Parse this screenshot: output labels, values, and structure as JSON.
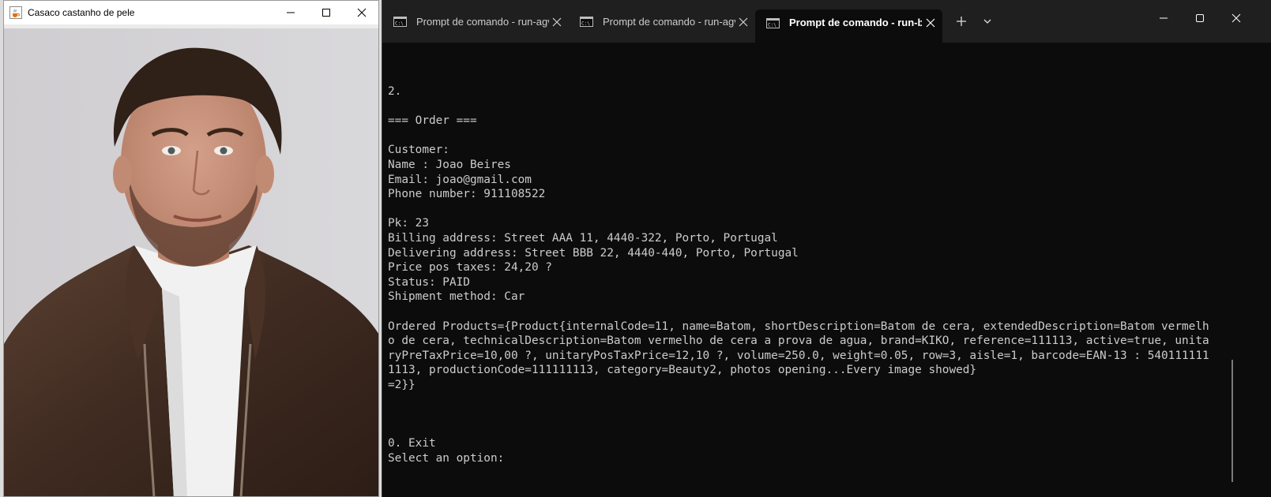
{
  "image_window": {
    "title": "Casaco castanho de pele",
    "icon": "java-coffee-cup-icon"
  },
  "terminal": {
    "tabs": [
      {
        "label": "Prompt de comando - run-agv",
        "active": false
      },
      {
        "label": "Prompt de comando - run-agv",
        "active": false
      },
      {
        "label": "Prompt de comando - run-ba",
        "active": true
      }
    ],
    "lines": [
      "2.",
      "",
      "=== Order ===",
      "",
      "Customer:",
      "Name : Joao Beires",
      "Email: joao@gmail.com",
      "Phone number: 911108522",
      "",
      "Pk: 23",
      "Billing address: Street AAA 11, 4440-322, Porto, Portugal",
      "Delivering address: Street BBB 22, 4440-440, Porto, Portugal",
      "Price pos taxes: 24,20 ?",
      "Status: PAID",
      "Shipment method: Car",
      "",
      "Ordered Products={Product{internalCode=11, name=Batom, shortDescription=Batom de cera, extendedDescription=Batom vermelh",
      "o de cera, technicalDescription=Batom vermelho de cera a prova de agua, brand=KIKO, reference=111113, active=true, unita",
      "ryPreTaxPrice=10,00 ?, unitaryPosTaxPrice=12,10 ?, volume=250.0, weight=0.05, row=3, aisle=1, barcode=EAN-13 : 540111111",
      "1113, productionCode=111111113, category=Beauty2, photos opening...Every image showed}",
      "=2}}",
      "",
      "",
      "",
      "0. Exit",
      "Select an option:"
    ]
  },
  "colors": {
    "terminal_bg": "#0c0c0c",
    "terminal_text": "#cccccc",
    "tabbar_bg": "#1f1f1f",
    "image_titlebar": "#ffffff"
  }
}
